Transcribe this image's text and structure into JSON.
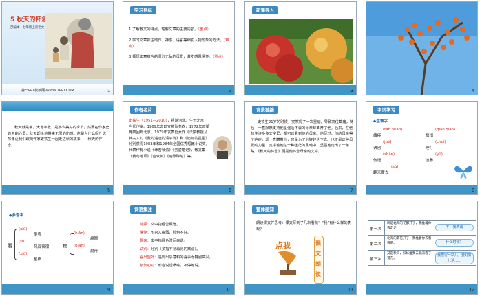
{
  "slides": [
    {
      "num": "1",
      "title": "5  秋天的怀念",
      "subtitle": "部编本 · 七年级上册语文",
      "footer": "第一PPT模板网-WWW.1PPT.COM"
    },
    {
      "num": "2",
      "tag": "学习目标",
      "lines": [
        {
          "text": "1.了解散文的特点，理解文章的主要内容。",
          "note": "（重点）"
        },
        {
          "text": "2.学习文章抓住动作、神态、语言等细腻人物形象的方法。",
          "note": "（难点）"
        },
        {
          "text": "3.领悟文章蕴含的深沉无私的母爱，激发感恩情怀。",
          "note": "（重点）"
        }
      ]
    },
    {
      "num": "3",
      "tag": "新课导入"
    },
    {
      "num": "4"
    },
    {
      "num": "5",
      "text": "秋天就是菊，大地丰收，是多么美好的季节。然而在作家史铁生的心里，秋天却给他带来无限的伤感。这是为什么呢？这节课让我们跟随作家史铁生一起走进秋的故事——秋天的怀念。"
    },
    {
      "num": "6",
      "tag": "作者名片",
      "author_name": "史铁生",
      "author_dates": "（1951—2010）",
      "text": "，祖籍河北，生于北京，当代作家。1969年去延安插队务农，1972年双腿瘫痪回到北京。1979年发表处女作《法学教授及其夫人》，《我的遥远的清平湾》和《奶奶的星星》分别获得1983年和1984年全国优秀短篇小说奖。代表作有小说《命若琴弦》《务虚笔记》，散文集《我与地坛》《合欢树》《病隙碎笔》等。"
    },
    {
      "num": "7",
      "tag": "背景链接",
      "text": "史铁生21岁的时候，突然得了一次重病，导致高位截瘫，随后，一直默默支持他坚强活下去的母亲却离开了他。后来，在他的许许多多文字里，都可以看到他的母亲。他写过，他的母亲得了绝症，却一直瞒着他，只是为了他好好活下去。也正是这种母爱的力量，支撑着他在一种迷茫的黑暗中，坚强地走出了一条路。《秋天的怀念》便是他怀念母亲的文章。"
    },
    {
      "num": "8",
      "tag": "字词学习",
      "section": "生难字",
      "words": [
        {
          "py": "(tān huàn)",
          "zi": "瘫痪"
        },
        {
          "py": "(qiāo qiāo)",
          "zi": "悄悄"
        },
        {
          "py": "(jué)",
          "zi": "诀别"
        },
        {
          "py": "(chuí)",
          "zi": "捶打"
        },
        {
          "py": "(shǎn)",
          "zi": "伤逝"
        },
        {
          "py": "(yǔ)",
          "zi": "淡雅"
        },
        {
          "py": "(sù)",
          "zi": "翻来覆去"
        }
      ]
    },
    {
      "num": "9",
      "section": "多音字",
      "head": "看",
      "readings": [
        {
          "py": "(xiū)",
          "word": "墨宥"
        },
        {
          "py": "(sù)",
          "word": "风闻宿宿"
        },
        {
          "py": "(xiù)",
          "word": "星宿"
        }
      ],
      "head2": "扁",
      "readings2": [
        {
          "py": "(biǎn)",
          "word": "扁圆"
        },
        {
          "py": "(piān)",
          "word": "扁舟"
        }
      ]
    },
    {
      "num": "10",
      "tag": "词语集注",
      "items": [
        {
          "term": "侍弄：",
          "def": "文中指经营照管。"
        },
        {
          "term": "憔悴：",
          "def": "形容人瘦弱，脸色不好。"
        },
        {
          "term": "翻来：",
          "def": "文中指翻色时间来说。"
        },
        {
          "term": "诀别：",
          "def": "分别（多指不易再见的离别）。"
        },
        {
          "term": "喜出望外：",
          "def": "遇到出乎意料的喜事而特别高兴。"
        },
        {
          "term": "絮絮叨叨：",
          "def": "形容说话啰嗦，不停地说。"
        }
      ]
    },
    {
      "num": "11",
      "tag": "整体感知",
      "question": "朗读课文并思考：课文写到了几次看花？“我”有什么样的表现？",
      "badge": "点我",
      "vertical": "课文朗读"
    },
    {
      "num": "12",
      "rows": [
        {
          "label": "第一次",
          "text": "听说北海的花都开了，我推着你去走走",
          "answer": "不，我不去"
        },
        {
          "label": "第二次",
          "text": "北海的菊花开了，我推着你去看看吧。",
          "answer": "什么时候？"
        },
        {
          "label": "第三次",
          "text": "又是秋天，妹妹推我去北海看了菊花。",
          "answer": "我懂得一块儿，要好好儿活……"
        }
      ]
    }
  ]
}
